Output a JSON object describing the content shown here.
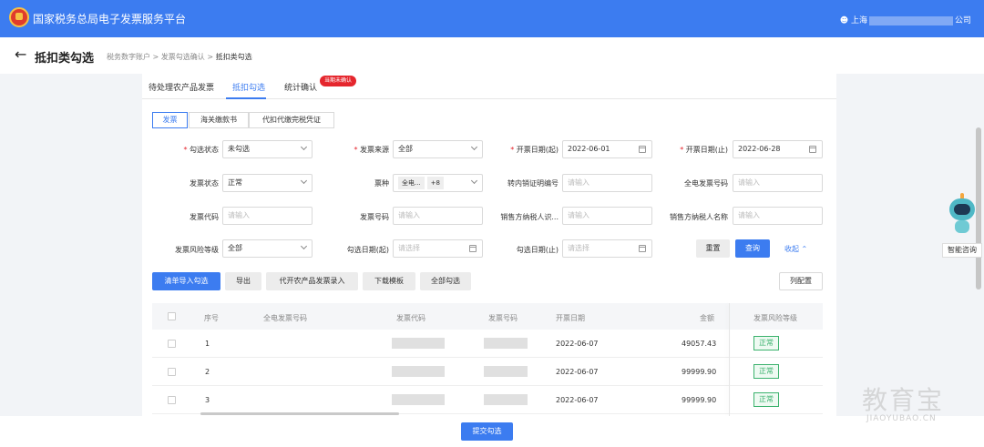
{
  "topbar": {
    "title": "国家税务总局电子发票服务平台",
    "user_prefix": "上海",
    "user_suffix": "公司"
  },
  "page": {
    "title": "抵扣类勾选",
    "breadcrumb": [
      "税务数字账户",
      "发票勾选确认",
      "抵扣类勾选"
    ]
  },
  "tabs": [
    {
      "label": "待处理农产品发票"
    },
    {
      "label": "抵扣勾选"
    },
    {
      "label": "统计确认"
    }
  ],
  "badge": "当期未确认",
  "doc_types": [
    "发票",
    "海关缴款书",
    "代扣代缴完税凭证"
  ],
  "filters": {
    "select_status": {
      "label": "勾选状态",
      "value": "未勾选"
    },
    "invoice_source": {
      "label": "发票来源",
      "value": "全部"
    },
    "issue_date_start": {
      "label": "开票日期(起)",
      "value": "2022-06-01"
    },
    "issue_date_end": {
      "label": "开票日期(止)",
      "value": "2022-06-28"
    },
    "invoice_status": {
      "label": "发票状态",
      "value": "正常"
    },
    "ticket_type": {
      "label": "票种",
      "tag1": "全电...",
      "tag2": "+8"
    },
    "transfer_cert_no": {
      "label": "转内销证明编号",
      "placeholder": "请输入"
    },
    "full_invoice_no": {
      "label": "全电发票号码",
      "placeholder": "请输入"
    },
    "invoice_code": {
      "label": "发票代码",
      "placeholder": "请输入"
    },
    "invoice_number": {
      "label": "发票号码",
      "placeholder": "请输入"
    },
    "seller_tax_id": {
      "label": "销售方纳税人识...",
      "placeholder": "请输入"
    },
    "seller_name": {
      "label": "销售方纳税人名称",
      "placeholder": "请输入"
    },
    "risk_level": {
      "label": "发票风险等级",
      "value": "全部"
    },
    "select_date_start": {
      "label": "勾选日期(起)",
      "placeholder": "请选择"
    },
    "select_date_end": {
      "label": "勾选日期(止)",
      "placeholder": "请选择"
    }
  },
  "actions": {
    "reset": "重置",
    "query": "查询",
    "collapse": "收起"
  },
  "toolbar": {
    "import_select": "清单导入勾选",
    "export": "导出",
    "agri_entry": "代开农产品发票录入",
    "download_template": "下载模板",
    "select_all": "全部勾选",
    "column_config": "列配置"
  },
  "table": {
    "headers": {
      "seq": "序号",
      "full_no": "全电发票号码",
      "code": "发票代码",
      "number": "发票号码",
      "date": "开票日期",
      "amount": "金额",
      "risk": "发票风险等级"
    },
    "rows": [
      {
        "seq": "1",
        "date": "2022-06-07",
        "amount": "49057.43",
        "risk": "正常"
      },
      {
        "seq": "2",
        "date": "2022-06-07",
        "amount": "99999.90",
        "risk": "正常"
      },
      {
        "seq": "3",
        "date": "2022-06-07",
        "amount": "99999.90",
        "risk": "正常"
      }
    ]
  },
  "footer": {
    "submit": "提交勾选"
  },
  "assistant": {
    "label": "智能咨询"
  },
  "watermark": {
    "main": "教育宝",
    "sub": "JIAOYUBAO.CN"
  }
}
